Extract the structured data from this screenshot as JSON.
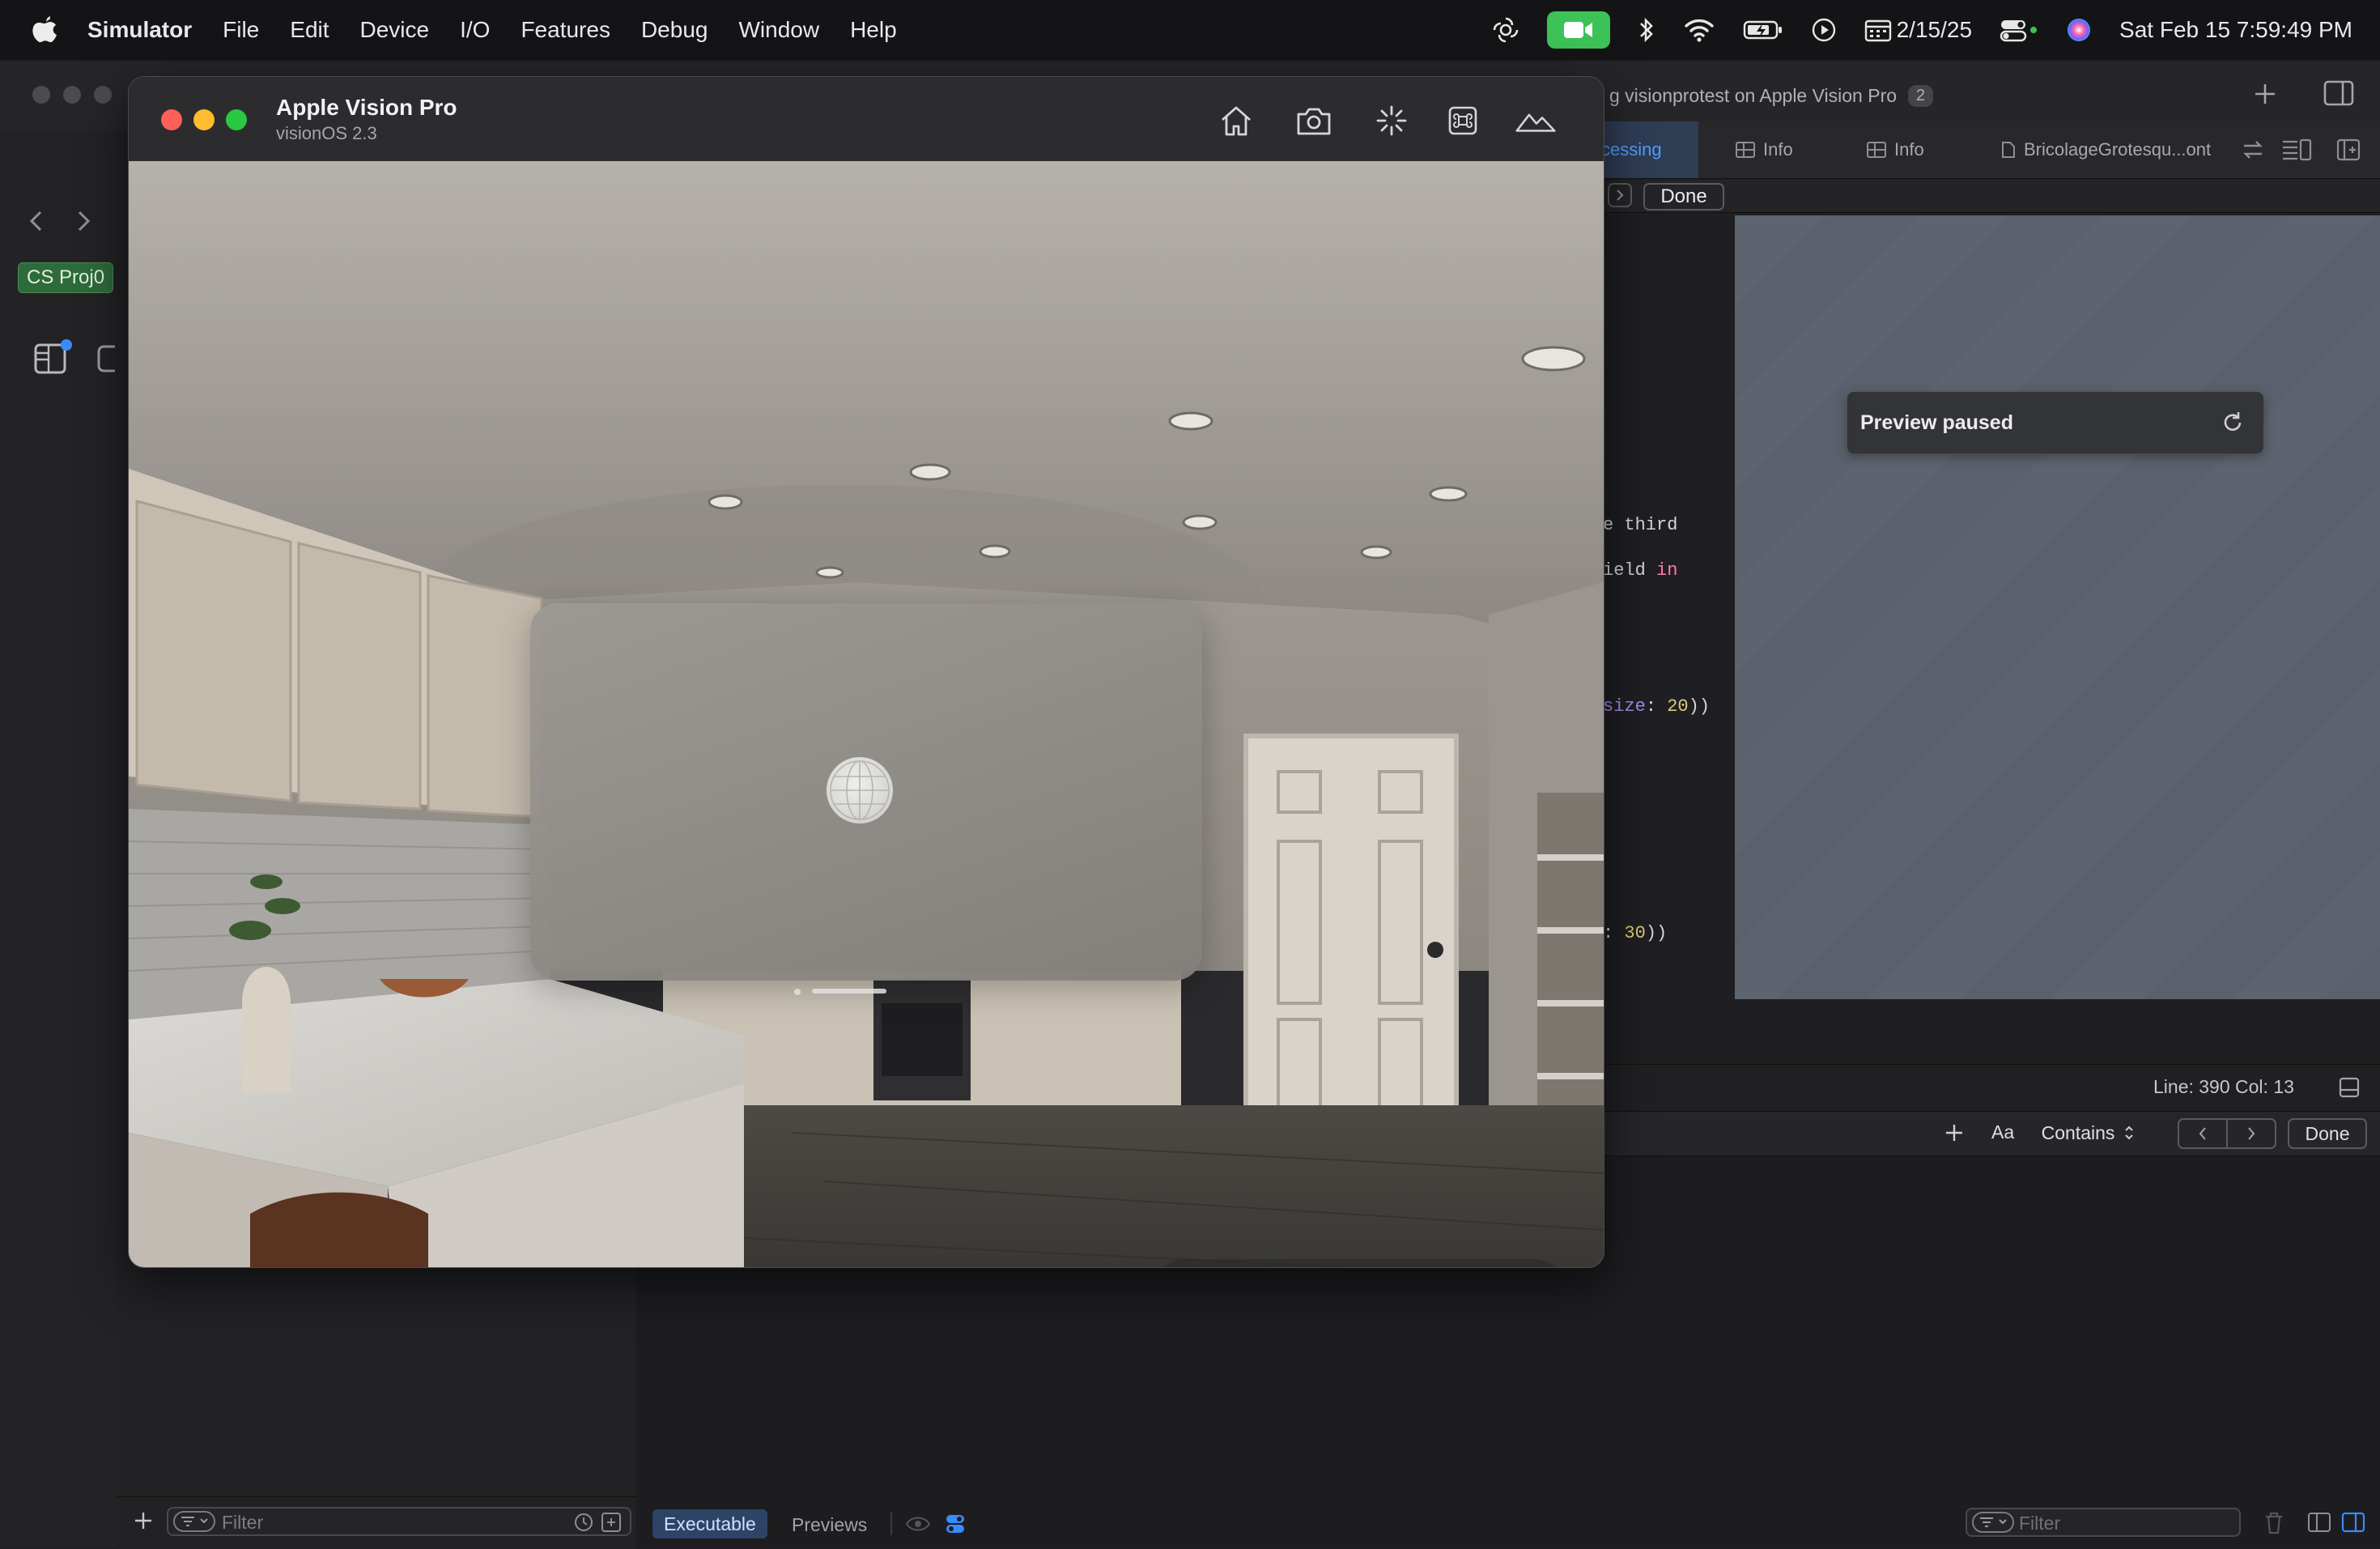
{
  "menubar": {
    "app_name": "Simulator",
    "menus": [
      "File",
      "Edit",
      "Device",
      "I/O",
      "Features",
      "Debug",
      "Window",
      "Help"
    ],
    "date_short": "2/15/25",
    "clock": "Sat Feb 15  7:59:49 PM"
  },
  "xcode": {
    "scheme_chip": "CS Proj0",
    "activity_text": "g visionprotest on Apple Vision Pro",
    "activity_badge": "2",
    "tabs": [
      "cessing",
      "Info",
      "Info",
      "BricolageGrotesqu...ont"
    ],
    "done_label": "Done",
    "code_lines": [
      {
        "text": "e third",
        "cls": "cm"
      },
      {
        "text": "ield in",
        "cls": "mix1"
      },
      {
        "text": "size: 20))",
        "cls": "mix2"
      },
      {
        "text": ": 30))",
        "cls": "mix3"
      }
    ],
    "preview_status": "Preview paused",
    "status_line": "Line: 390  Col: 13",
    "find_bar": {
      "aa_label": "Aa",
      "mode_label": "Contains",
      "done_label": "Done"
    },
    "bottom": {
      "filter_placeholder_left": "Filter",
      "executable_tab": "Executable",
      "previews_tab": "Previews",
      "filter_placeholder_right": "Filter"
    }
  },
  "simulator": {
    "device_name": "Apple Vision Pro",
    "os_version": "visionOS 2.3",
    "toolbar_icons": [
      "home-icon",
      "camera-icon",
      "shake-icon",
      "command-icon",
      "environment-icon"
    ],
    "bottom_tools": [
      "interact-cursor-icon",
      "look-around-icon",
      "pan-icon",
      "orbit-icon",
      "zoom-icon",
      "capture-video-icon"
    ]
  }
}
